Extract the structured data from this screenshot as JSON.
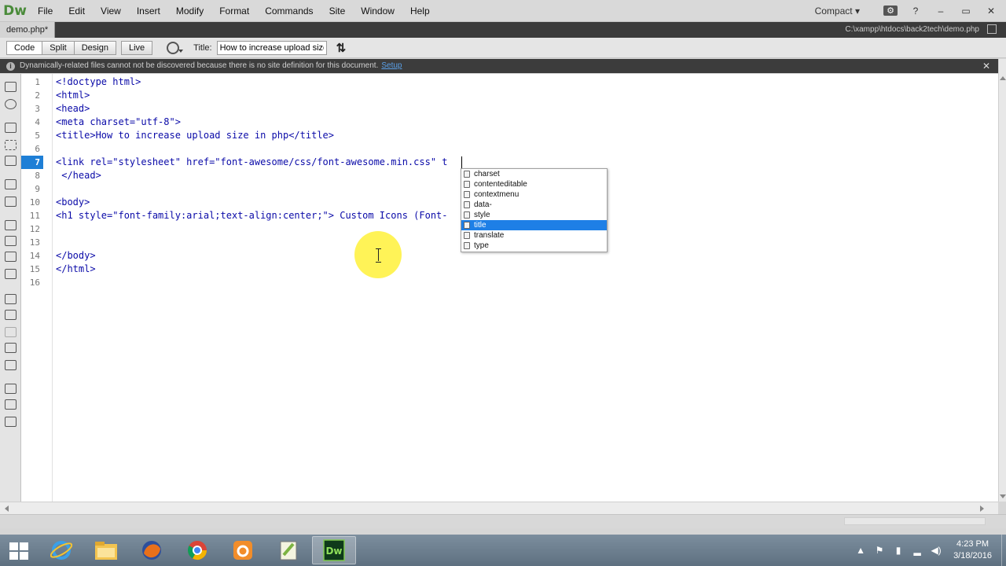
{
  "app": {
    "logo": "Dw",
    "menu": [
      "File",
      "Edit",
      "View",
      "Insert",
      "Modify",
      "Format",
      "Commands",
      "Site",
      "Window",
      "Help"
    ],
    "workspace": "Compact",
    "workspace_caret": "▾"
  },
  "window_controls": {
    "gear": "⚙",
    "help": "?",
    "minimize": "–",
    "restore": "▭",
    "close": "✕"
  },
  "document": {
    "tab_label": "demo.php*",
    "path": "C:\\xampp\\htdocs\\back2tech\\demo.php"
  },
  "toolbar": {
    "view_buttons": [
      "Code",
      "Split",
      "Design",
      "Live"
    ],
    "active_view": "Code",
    "title_label": "Title:",
    "title_value": "How to increase upload size in php"
  },
  "infobar": {
    "message": "Dynamically-related files cannot not be discovered because there is no site definition for this document.",
    "link": "Setup",
    "close": "✕"
  },
  "editor": {
    "line_numbers": [
      "1",
      "2",
      "3",
      "4",
      "5",
      "6",
      "7",
      "8",
      "9",
      "10",
      "11",
      "12",
      "13",
      "14",
      "15",
      "16"
    ],
    "active_line": "7",
    "lines": [
      "<!doctype html>",
      "<html>",
      "<head>",
      "<meta charset=\"utf-8\">",
      "<title>How to increase upload size in php</title>",
      "",
      "<link rel=\"stylesheet\" href=\"font-awesome/css/font-awesome.min.css\" t",
      " </head>",
      "",
      "<body>",
      "<h1 style=\"font-family:arial;text-align:center;\"> Custom Icons (Font-                    /h1>",
      "",
      "",
      "</body>",
      "</html>",
      ""
    ]
  },
  "autocomplete": {
    "items": [
      "charset",
      "contenteditable",
      "contextmenu",
      "data-",
      "style",
      "title",
      "translate",
      "type"
    ],
    "selected": "title"
  },
  "taskbar": {
    "apps": [
      "internet-explorer",
      "file-explorer",
      "firefox",
      "chrome",
      "uc-browser",
      "notepad-plus-plus",
      "dreamweaver"
    ],
    "active_app": "dreamweaver",
    "dreamweaver_label": "Dw",
    "time": "4:23 PM",
    "date": "3/18/2016"
  },
  "colors": {
    "selection_blue": "#1e7fe6",
    "code_blue": "#0a0aa8",
    "dw_green": "#4a8b3a",
    "cursor_halo": "#fff028"
  }
}
